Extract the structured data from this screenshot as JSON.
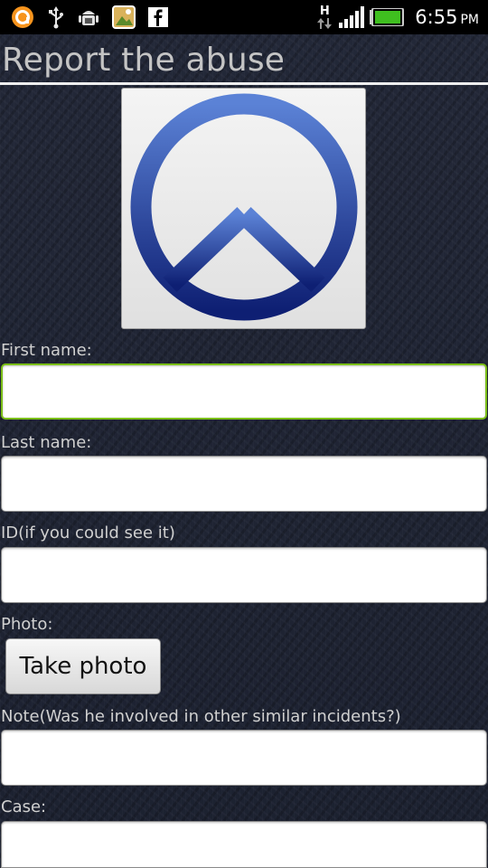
{
  "status_bar": {
    "icons_left": [
      "orange-app-icon",
      "usb-icon",
      "android-debug-icon",
      "picture-icon",
      "facebook-icon"
    ],
    "network_label": "H",
    "time": "6:55",
    "ampm": "PM"
  },
  "header": {
    "title": "Report the abuse"
  },
  "logo": {
    "icon": "peace-icon"
  },
  "form": {
    "first_name_label": "First name:",
    "first_name_value": "",
    "last_name_label": "Last name:",
    "last_name_value": "",
    "id_label": "ID(if you could see it)",
    "id_value": "",
    "photo_label": "Photo:",
    "take_photo_label": "Take photo",
    "note_label": "Note(Was he involved in other similar incidents?)",
    "note_value": "",
    "case_label": "Case:",
    "case_value": ""
  },
  "colors": {
    "focus_border": "#7bbf18",
    "peace_top": "#5b82d6",
    "peace_bottom": "#0e1f73"
  }
}
